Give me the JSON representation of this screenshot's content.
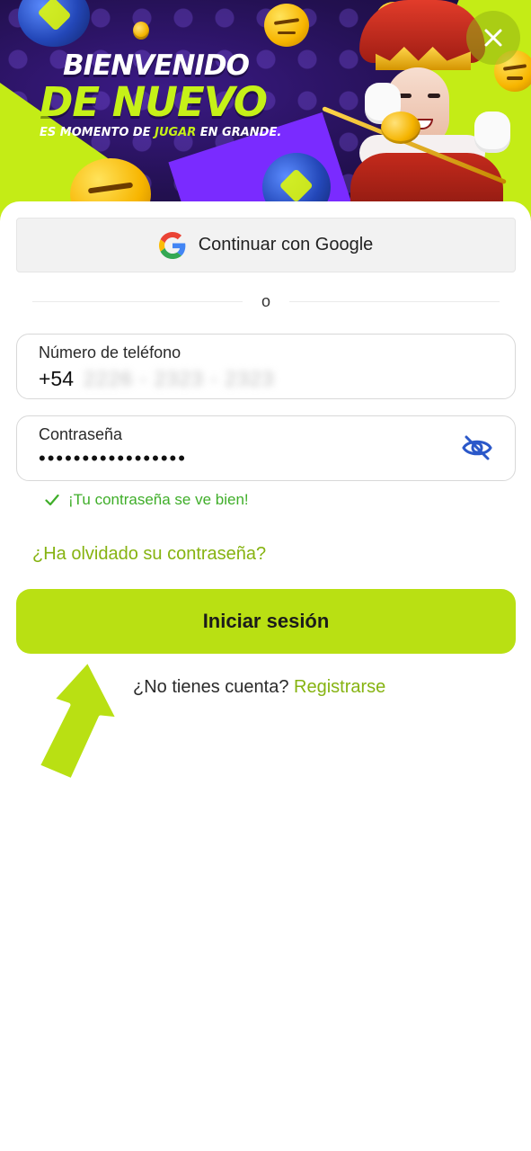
{
  "banner": {
    "title_line1": "BIENVENIDO",
    "title_line2": "DE NUEVO",
    "subtitle_before": "ES MOMENTO DE ",
    "subtitle_highlight": "JUGAR",
    "subtitle_after": " EN GRANDE.",
    "close_icon": "close-icon"
  },
  "google": {
    "label": "Continuar con Google",
    "icon": "google-logo-icon"
  },
  "divider": {
    "text": "o"
  },
  "phone_field": {
    "label": "Número de teléfono",
    "prefix": "+54",
    "value_masked": "2226 - 2323 - 2323"
  },
  "password_field": {
    "label": "Contraseña",
    "value": "•••••••••••••••••",
    "toggle_icon": "eye-slash-icon"
  },
  "password_hint": {
    "icon": "check-icon",
    "text": "¡Tu contraseña se ve bien!"
  },
  "forgot_link": "¿Ha olvidado su contraseña?",
  "login_button": "Iniciar sesión",
  "register": {
    "prompt": "¿No tienes cuenta?",
    "link": "Registrarse"
  },
  "colors": {
    "accent": "#b9e013",
    "link": "#86b311",
    "success": "#3fae29",
    "banner_bg": "#22104f",
    "eye_icon": "#2b58c9"
  }
}
